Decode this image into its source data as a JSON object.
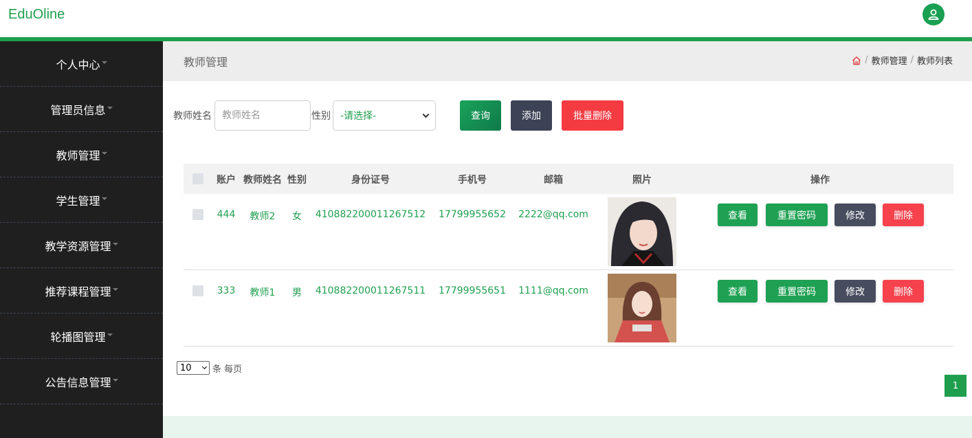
{
  "header": {
    "brand": "EduOline",
    "user_icon": "user-icon",
    "accent_color": "#1f9f4e"
  },
  "sidebar": {
    "items": [
      {
        "label": "个人中心"
      },
      {
        "label": "管理员信息"
      },
      {
        "label": "教师管理"
      },
      {
        "label": "学生管理"
      },
      {
        "label": "教学资源管理"
      },
      {
        "label": "推荐课程管理"
      },
      {
        "label": "轮播图管理"
      },
      {
        "label": "公告信息管理"
      }
    ]
  },
  "page": {
    "title": "教师管理",
    "breadcrumb": {
      "icon": "home-icon",
      "items": [
        "教师管理",
        "教师列表"
      ]
    }
  },
  "filters": {
    "name_label": "教师姓名",
    "name_placeholder": "教师姓名",
    "gender_label": "性别",
    "gender_selected": "-请选择-",
    "query_button": "查询",
    "add_button": "添加",
    "batch_delete_button": "批量删除"
  },
  "table": {
    "columns": [
      "账户",
      "教师姓名",
      "性别",
      "身份证号",
      "手机号",
      "邮箱",
      "照片",
      "操作"
    ],
    "rows": [
      {
        "account": "444",
        "name": "教师2",
        "gender": "女",
        "id_number": "410882200011267512",
        "phone": "17799955652",
        "email": "2222@qq.com"
      },
      {
        "account": "333",
        "name": "教师1",
        "gender": "男",
        "id_number": "410882200011267511",
        "phone": "17799955651",
        "email": "1111@qq.com"
      }
    ],
    "actions": {
      "view": "查看",
      "reset_password": "重置密码",
      "edit": "修改",
      "delete": "删除"
    }
  },
  "pagination": {
    "page_size": "10",
    "page_size_suffix": "条 每页",
    "current_page": "1"
  }
}
